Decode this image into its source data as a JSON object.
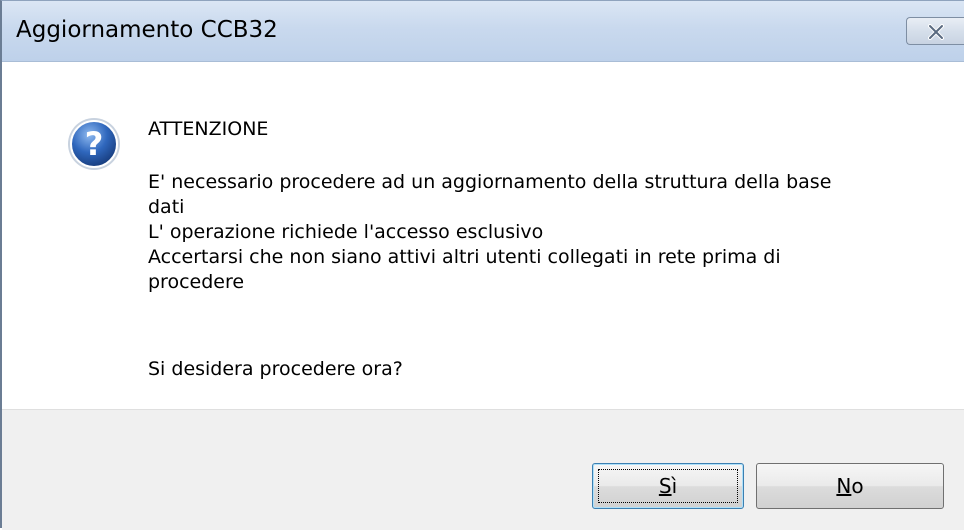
{
  "window": {
    "title": "Aggiornamento CCB32"
  },
  "dialog": {
    "icon": "question-icon",
    "heading": "ATTENZIONE",
    "message_lines": [
      "E' necessario procedere ad un aggiornamento della struttura della base",
      "dati",
      "L' operazione richiede l'accesso esclusivo",
      "Accertarsi che non siano attivi altri utenti collegati in rete prima di",
      "procedere"
    ],
    "question": "Si desidera procedere ora?"
  },
  "buttons": {
    "yes": {
      "mnemonic": "S",
      "rest": "ì"
    },
    "no": {
      "mnemonic": "N",
      "rest": "o"
    }
  },
  "colors": {
    "titlebar": "#c9d9ee",
    "footer": "#f0f0f0",
    "icon_blue": "#2a5ca8"
  }
}
